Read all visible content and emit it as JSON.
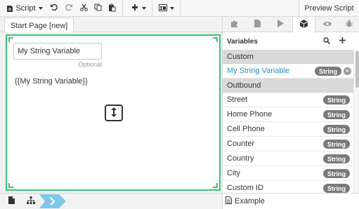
{
  "toolbar": {
    "script_menu_label": "Script",
    "preview_label": "Preview Script"
  },
  "page_tab": {
    "label": "Start Page [new]"
  },
  "canvas": {
    "input_value": "My String Variable",
    "optional_hint": "Optional",
    "token_text": "{{My String Variable}}"
  },
  "panel": {
    "header_title": "Variables",
    "sections": [
      {
        "title": "Custom",
        "items": [
          {
            "name": "My String Variable",
            "type": "String",
            "selected": true
          }
        ]
      },
      {
        "title": "Outbound",
        "items": [
          {
            "name": "Street",
            "type": "String"
          },
          {
            "name": "Home Phone",
            "type": "String"
          },
          {
            "name": "Cell Phone",
            "type": "String"
          },
          {
            "name": "Counter",
            "type": "String"
          },
          {
            "name": "Country",
            "type": "String"
          },
          {
            "name": "City",
            "type": "String"
          },
          {
            "name": "Custom ID",
            "type": "String"
          }
        ]
      }
    ]
  },
  "bottom": {
    "example_label": "Example"
  },
  "icons": {
    "toolbar": [
      "script-icon",
      "undo-icon",
      "redo-icon",
      "cut-icon",
      "copy-icon",
      "paste-icon",
      "widget-icon",
      "layout-icon"
    ],
    "panel_tabs": [
      "puzzle-icon",
      "document-icon",
      "play-icon",
      "cube-icon",
      "eye-icon",
      "bug-icon"
    ],
    "bottom": [
      "page-icon",
      "sitemap-icon",
      "chevron-right-icon",
      "document-icon"
    ]
  },
  "colors": {
    "accent_green": "#3cc177",
    "link_blue": "#2a8fc1",
    "badge_gray": "#7a7a7a",
    "chevron_blue": "#7ec8ea"
  }
}
